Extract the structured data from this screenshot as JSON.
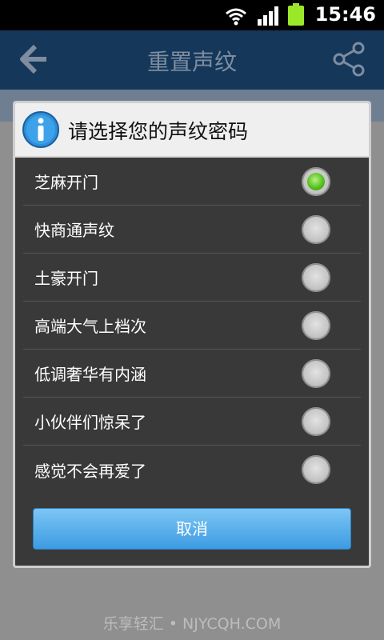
{
  "status_bar": {
    "time": "15:46"
  },
  "app_bar": {
    "title": "重置声纹"
  },
  "dialog": {
    "title": "请选择您的声纹密码",
    "options": [
      {
        "label": "芝麻开门",
        "selected": true
      },
      {
        "label": "快商通声纹",
        "selected": false
      },
      {
        "label": "土豪开门",
        "selected": false
      },
      {
        "label": "高端大气上档次",
        "selected": false
      },
      {
        "label": "低调奢华有内涵",
        "selected": false
      },
      {
        "label": "小伙伴们惊呆了",
        "selected": false
      },
      {
        "label": "感觉不会再爱了",
        "selected": false
      }
    ],
    "cancel_label": "取消"
  },
  "footer": {
    "watermark": "乐享轻汇 • NJYCQH.COM"
  },
  "colors": {
    "accent": "#3d9be2",
    "selected_radio": "#56c21d",
    "app_bar": "#14375a"
  }
}
